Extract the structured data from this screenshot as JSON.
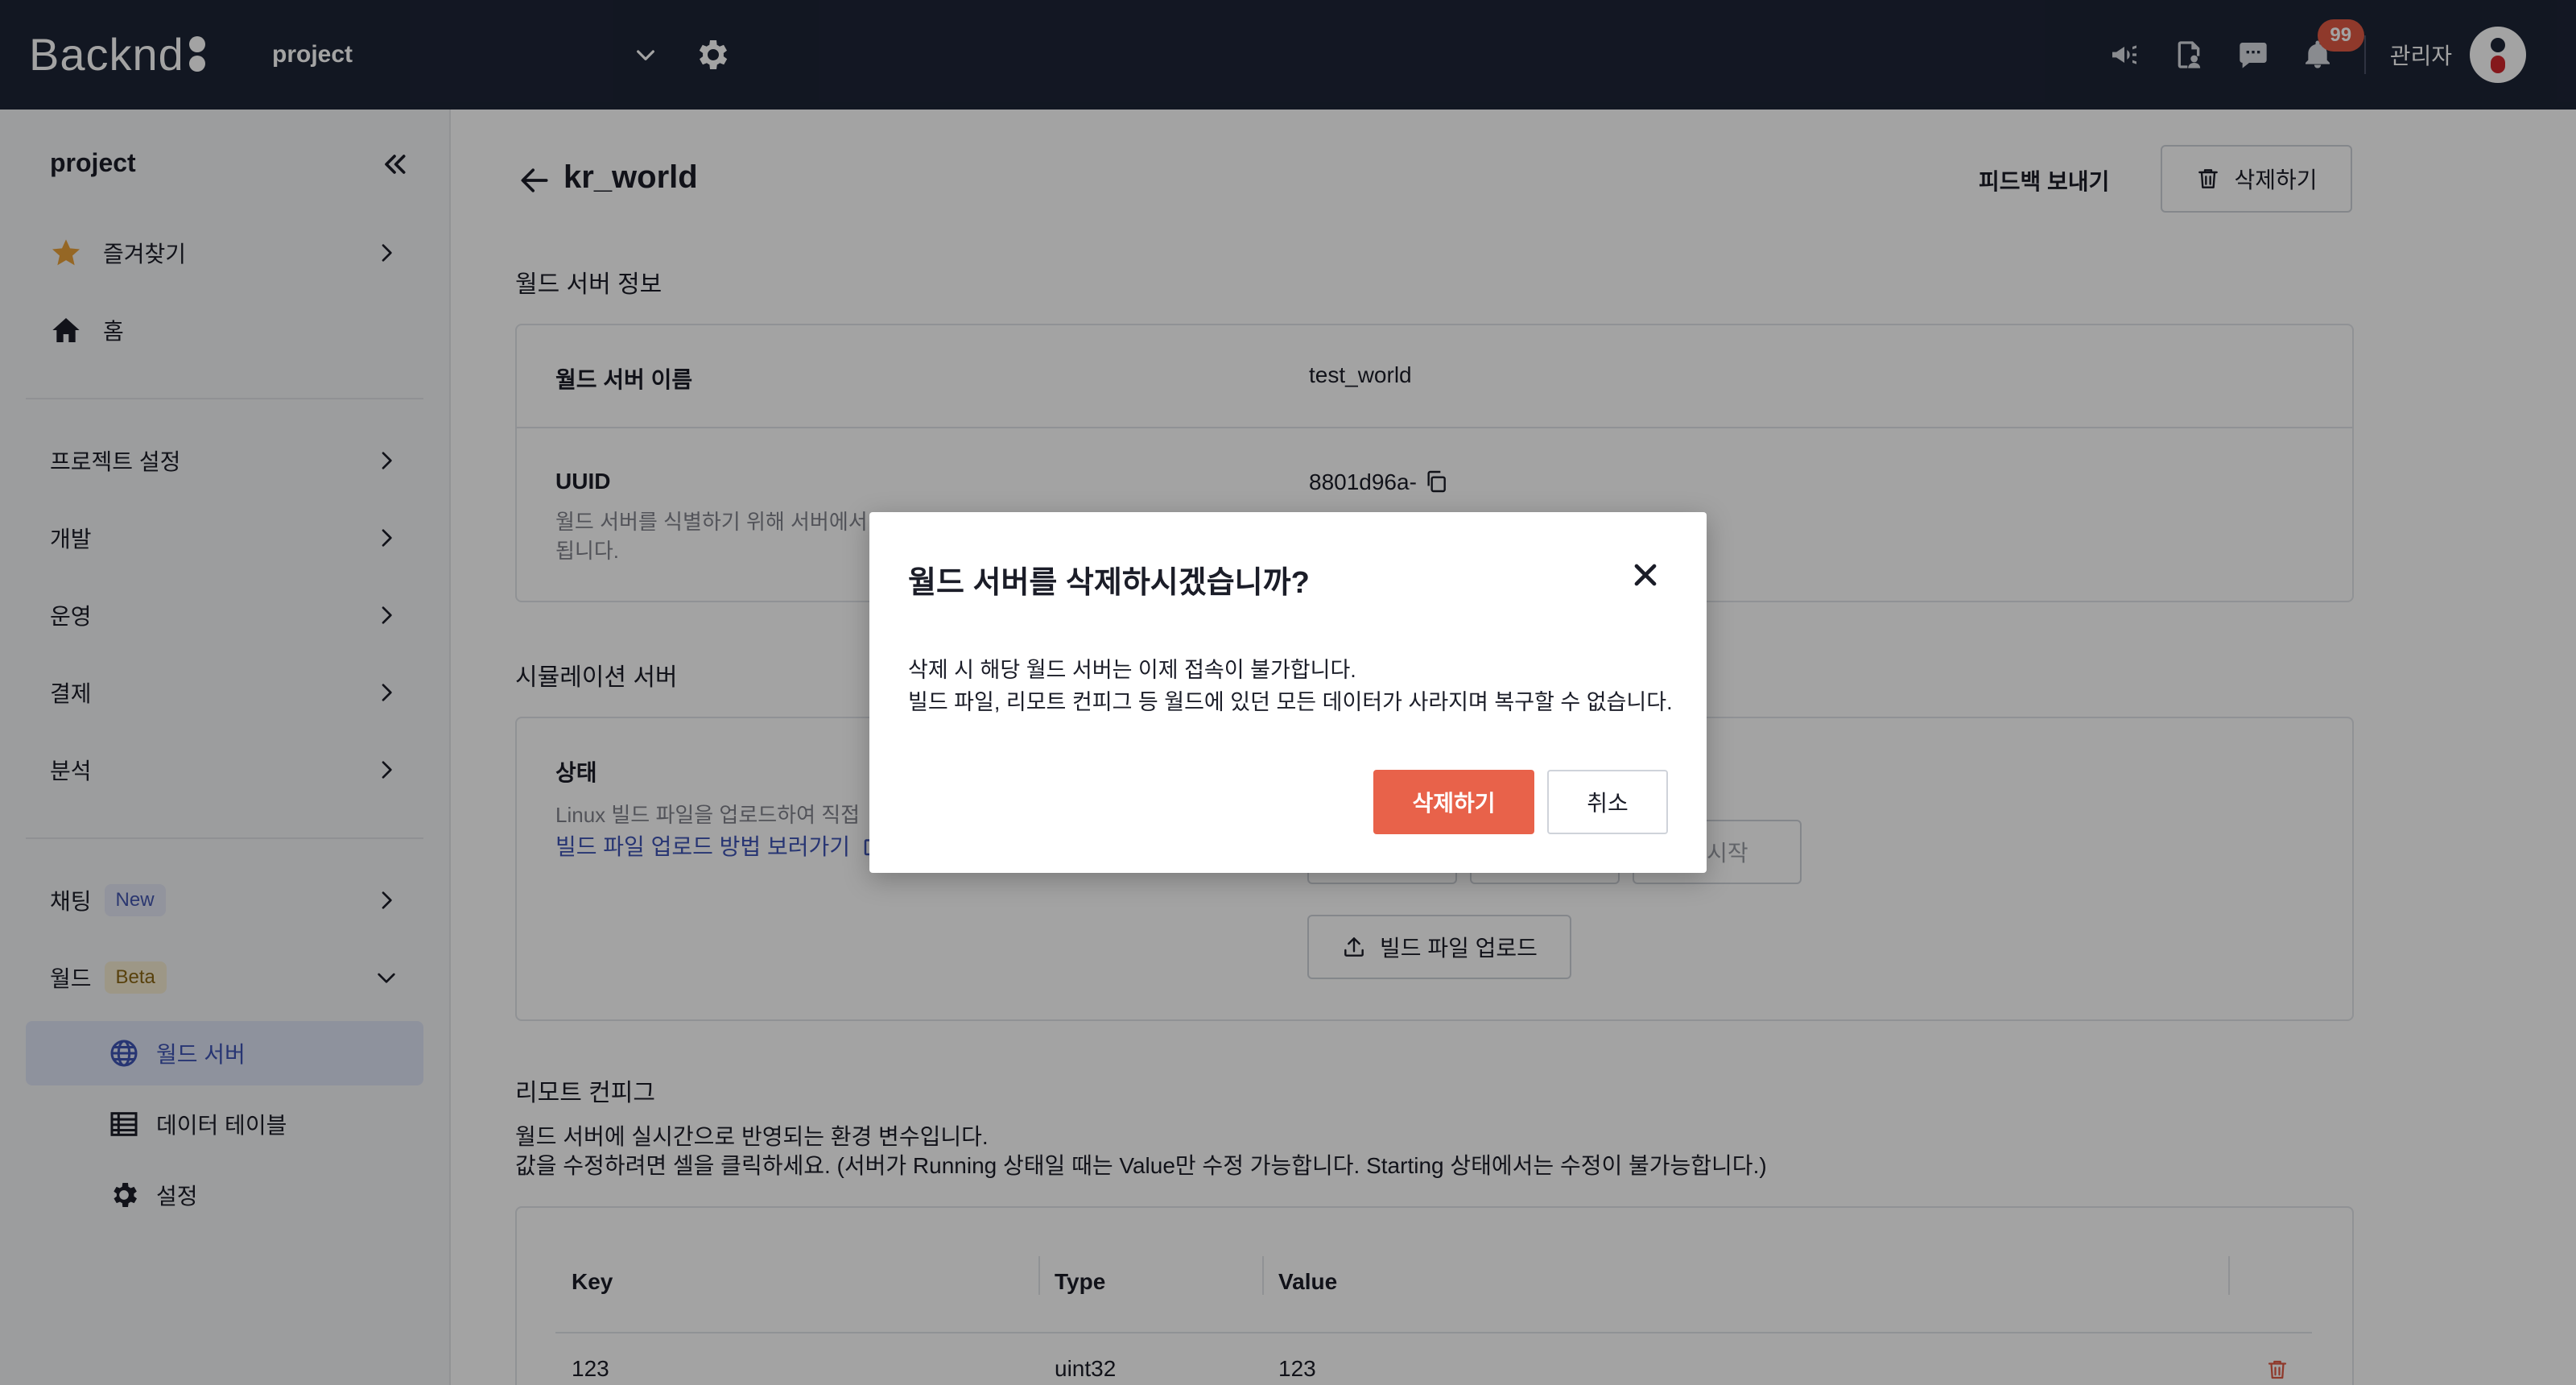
{
  "header": {
    "logo": "Backnd",
    "project_name": "project",
    "admin_label": "관리자",
    "notification_count": "99"
  },
  "sidebar": {
    "title": "project",
    "items": {
      "favorites": "즐겨찾기",
      "home": "홈",
      "project_settings": "프로젝트 설정",
      "development": "개발",
      "operation": "운영",
      "payment": "결제",
      "analytics": "분석",
      "chatting": "채팅",
      "chatting_tag": "New",
      "world": "월드",
      "world_tag": "Beta"
    },
    "world_sub": {
      "world_server": "월드 서버",
      "data_table": "데이터 테이블",
      "settings": "설정"
    }
  },
  "main": {
    "title": "kr_world",
    "feedback_label": "피드백 보내기",
    "delete_label": "삭제하기",
    "server_info": {
      "section_title": "월드 서버 정보",
      "name_label": "월드 서버 이름",
      "name_value": "test_world",
      "uuid_label": "UUID",
      "uuid_value": "8801d96a-",
      "uuid_desc_1": "월드 서버를 식별하기 위해 서버에서",
      "uuid_desc_2": "됩니다."
    },
    "simulation": {
      "section_title": "시뮬레이션 서버",
      "status_label": "상태",
      "status_desc": "Linux 빌드 파일을 업로드하여 직접",
      "guide_link": "빌드 파일 업로드 방법 보러가기",
      "restart_label": "재시작",
      "upload_label": "빌드 파일 업로드"
    },
    "remote_config": {
      "section_title": "리모트 컨피그",
      "desc_1": "월드 서버에 실시간으로 반영되는 환경 변수입니다.",
      "desc_2": "값을 수정하려면 셀을 클릭하세요. (서버가 Running 상태일 때는 Value만 수정 가능합니다. Starting 상태에서는 수정이 불가능합니다.)",
      "columns": [
        "Key",
        "Type",
        "Value"
      ],
      "rows": [
        {
          "key": "123",
          "type": "uint32",
          "value": "123"
        }
      ]
    }
  },
  "modal": {
    "title": "월드 서버를 삭제하시겠습니까?",
    "body_line_1": "삭제 시 해당 월드 서버는 이제 접속이 불가합니다.",
    "body_line_2": "빌드 파일, 리모트 컨피그 등 월드에 있던 모든 데이터가 사라지며 복구할 수 없습니다.",
    "confirm_label": "삭제하기",
    "cancel_label": "취소"
  },
  "colors": {
    "topbar_bg": "#1d2436",
    "accent": "#3e53b4",
    "danger": "#e8624a",
    "badge": "#e05a44"
  }
}
